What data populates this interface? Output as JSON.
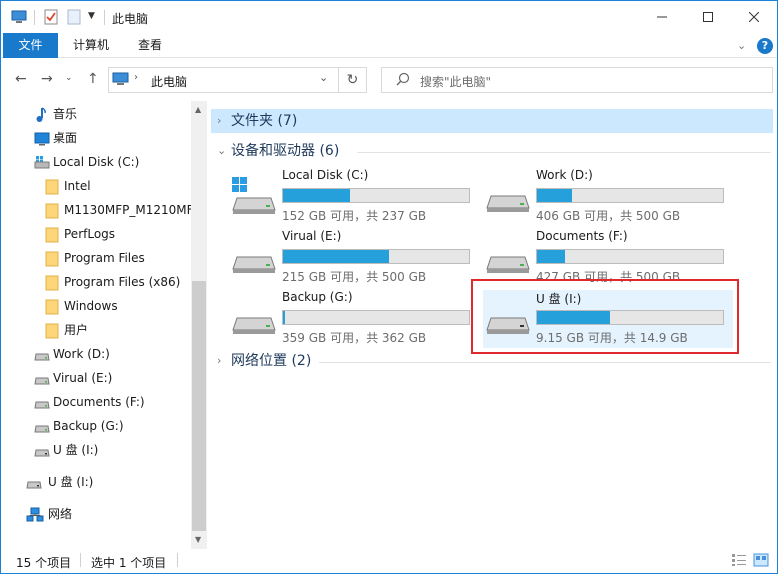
{
  "window": {
    "title": "此电脑"
  },
  "ribbon": {
    "tabs": [
      "文件",
      "计算机",
      "查看"
    ],
    "help": "?"
  },
  "address": {
    "path": "此电脑",
    "search_placeholder": "搜索\"此电脑\""
  },
  "sidebar": {
    "items": [
      {
        "label": "音乐",
        "icon": "music-icon",
        "indent": 0
      },
      {
        "label": "桌面",
        "icon": "desktop-icon",
        "indent": 0
      },
      {
        "label": "Local Disk (C:)",
        "icon": "windows-drive-icon",
        "indent": 0
      },
      {
        "label": "Intel",
        "icon": "folder-icon",
        "indent": 1
      },
      {
        "label": "M1130MFP_M1210MF",
        "icon": "folder-icon",
        "indent": 1
      },
      {
        "label": "PerfLogs",
        "icon": "folder-icon",
        "indent": 1
      },
      {
        "label": "Program Files",
        "icon": "folder-icon",
        "indent": 1
      },
      {
        "label": "Program Files (x86)",
        "icon": "folder-icon",
        "indent": 1
      },
      {
        "label": "Windows",
        "icon": "folder-icon",
        "indent": 1
      },
      {
        "label": "用户",
        "icon": "folder-icon",
        "indent": 1
      },
      {
        "label": "Work (D:)",
        "icon": "drive-icon",
        "indent": 0
      },
      {
        "label": "Virual (E:)",
        "icon": "drive-icon",
        "indent": 0
      },
      {
        "label": "Documents (F:)",
        "icon": "drive-icon",
        "indent": 0
      },
      {
        "label": "Backup (G:)",
        "icon": "drive-icon",
        "indent": 0
      },
      {
        "label": "U 盘 (I:)",
        "icon": "usb-drive-icon",
        "indent": 0
      }
    ],
    "extra": [
      {
        "label": "U 盘 (I:)",
        "icon": "usb-drive-icon"
      },
      {
        "label": "网络",
        "icon": "network-icon"
      }
    ]
  },
  "groups": {
    "folders": "文件夹 (7)",
    "devices": "设备和驱动器 (6)",
    "network": "网络位置 (2)"
  },
  "drives": [
    {
      "name": "Local Disk (C:)",
      "info": "152 GB 可用，共 237 GB",
      "used_fraction": 0.36,
      "icon": "windows-drive-icon"
    },
    {
      "name": "Work (D:)",
      "info": "406 GB 可用，共 500 GB",
      "used_fraction": 0.19,
      "icon": "drive-icon"
    },
    {
      "name": "Virual (E:)",
      "info": "215 GB 可用，共 500 GB",
      "used_fraction": 0.57,
      "icon": "drive-icon"
    },
    {
      "name": "Documents (F:)",
      "info": "427 GB 可用，共 500 GB",
      "used_fraction": 0.15,
      "icon": "drive-icon"
    },
    {
      "name": "Backup (G:)",
      "info": "359 GB 可用，共 362 GB",
      "used_fraction": 0.01,
      "icon": "drive-icon"
    },
    {
      "name": "U 盘 (I:)",
      "info": "9.15 GB 可用，共 14.9 GB",
      "used_fraction": 0.39,
      "icon": "usb-drive-icon"
    }
  ],
  "status": {
    "count": "15 个项目",
    "selected": "选中 1 个项目"
  },
  "colors": {
    "accent": "#1979ca",
    "bar": "#26a0da",
    "highlight": "#e0292c"
  }
}
